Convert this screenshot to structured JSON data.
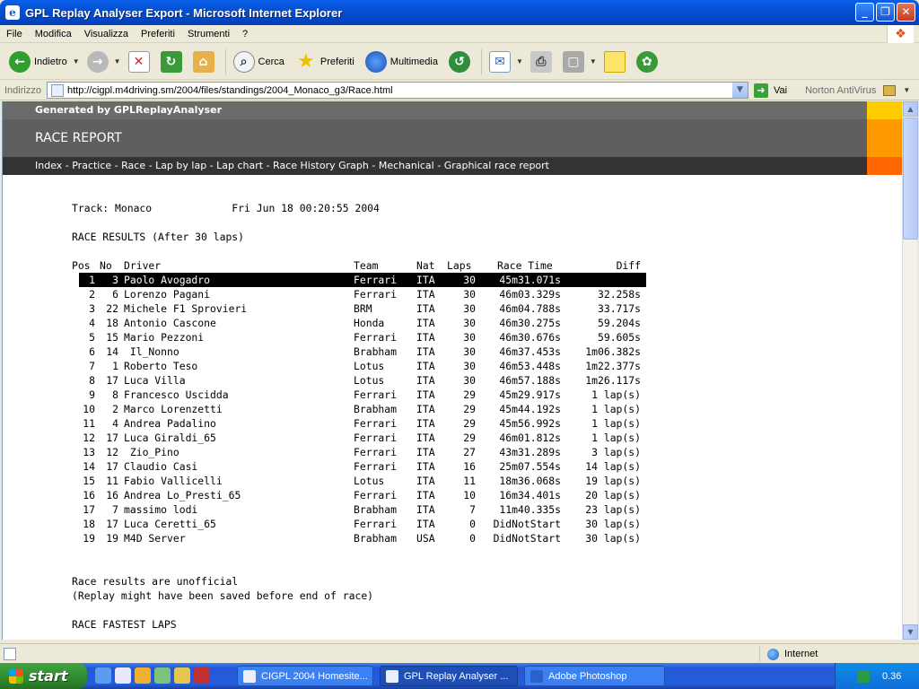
{
  "window": {
    "title": "GPL Replay Analyser Export - Microsoft Internet Explorer"
  },
  "menu": [
    "File",
    "Modifica",
    "Visualizza",
    "Preferiti",
    "Strumenti",
    "?"
  ],
  "toolbar": {
    "back": "Indietro",
    "search": "Cerca",
    "favorites": "Preferiti",
    "media": "Multimedia"
  },
  "address": {
    "label": "Indirizzo",
    "url": "http://cigpl.m4driving.sm/2004/files/standings/2004_Monaco_g3/Race.html",
    "go": "Vai",
    "norton": "Norton AntiVirus"
  },
  "page": {
    "generated_by": "Generated by GPLReplayAnalyser",
    "report_title": "RACE REPORT",
    "nav": "Index - Practice - Race - Lap by lap - Lap chart - Race History Graph - Mechanical - Graphical race report",
    "track_line": "Track: Monaco             Fri Jun 18 00:20:55 2004",
    "results_heading": "RACE RESULTS (After 30 laps)",
    "columns": {
      "pos": "Pos",
      "no": "No",
      "driver": "Driver",
      "team": "Team",
      "nat": "Nat",
      "laps": "Laps",
      "time": "Race Time",
      "diff": "Diff"
    },
    "results": [
      {
        "pos": "1",
        "no": "3",
        "driver": "Paolo Avogadro",
        "team": "Ferrari",
        "nat": "ITA",
        "laps": "30",
        "time": "45m31.071s",
        "diff": ""
      },
      {
        "pos": "2",
        "no": "6",
        "driver": "Lorenzo Pagani",
        "team": "Ferrari",
        "nat": "ITA",
        "laps": "30",
        "time": "46m03.329s",
        "diff": "32.258s"
      },
      {
        "pos": "3",
        "no": "22",
        "driver": "Michele F1 Sprovieri",
        "team": "BRM",
        "nat": "ITA",
        "laps": "30",
        "time": "46m04.788s",
        "diff": "33.717s"
      },
      {
        "pos": "4",
        "no": "18",
        "driver": "Antonio Cascone",
        "team": "Honda",
        "nat": "ITA",
        "laps": "30",
        "time": "46m30.275s",
        "diff": "59.204s"
      },
      {
        "pos": "5",
        "no": "15",
        "driver": "Mario Pezzoni",
        "team": "Ferrari",
        "nat": "ITA",
        "laps": "30",
        "time": "46m30.676s",
        "diff": "59.605s"
      },
      {
        "pos": "6",
        "no": "14",
        "driver": " Il_Nonno",
        "team": "Brabham",
        "nat": "ITA",
        "laps": "30",
        "time": "46m37.453s",
        "diff": "1m06.382s"
      },
      {
        "pos": "7",
        "no": "1",
        "driver": "Roberto Teso",
        "team": "Lotus",
        "nat": "ITA",
        "laps": "30",
        "time": "46m53.448s",
        "diff": "1m22.377s"
      },
      {
        "pos": "8",
        "no": "17",
        "driver": "Luca Villa",
        "team": "Lotus",
        "nat": "ITA",
        "laps": "30",
        "time": "46m57.188s",
        "diff": "1m26.117s"
      },
      {
        "pos": "9",
        "no": "8",
        "driver": "Francesco Uscidda",
        "team": "Ferrari",
        "nat": "ITA",
        "laps": "29",
        "time": "45m29.917s",
        "diff": "1 lap(s)"
      },
      {
        "pos": "10",
        "no": "2",
        "driver": "Marco Lorenzetti",
        "team": "Brabham",
        "nat": "ITA",
        "laps": "29",
        "time": "45m44.192s",
        "diff": "1 lap(s)"
      },
      {
        "pos": "11",
        "no": "4",
        "driver": "Andrea Padalino",
        "team": "Ferrari",
        "nat": "ITA",
        "laps": "29",
        "time": "45m56.992s",
        "diff": "1 lap(s)"
      },
      {
        "pos": "12",
        "no": "17",
        "driver": "Luca Giraldi_65",
        "team": "Ferrari",
        "nat": "ITA",
        "laps": "29",
        "time": "46m01.812s",
        "diff": "1 lap(s)"
      },
      {
        "pos": "13",
        "no": "12",
        "driver": " Zio_Pino",
        "team": "Ferrari",
        "nat": "ITA",
        "laps": "27",
        "time": "43m31.289s",
        "diff": "3 lap(s)"
      },
      {
        "pos": "14",
        "no": "17",
        "driver": "Claudio Casi",
        "team": "Ferrari",
        "nat": "ITA",
        "laps": "16",
        "time": "25m07.554s",
        "diff": "14 lap(s)"
      },
      {
        "pos": "15",
        "no": "11",
        "driver": "Fabio Vallicelli",
        "team": "Lotus",
        "nat": "ITA",
        "laps": "11",
        "time": "18m36.068s",
        "diff": "19 lap(s)"
      },
      {
        "pos": "16",
        "no": "16",
        "driver": "Andrea Lo_Presti_65",
        "team": "Ferrari",
        "nat": "ITA",
        "laps": "10",
        "time": "16m34.401s",
        "diff": "20 lap(s)"
      },
      {
        "pos": "17",
        "no": "7",
        "driver": "massimo lodi",
        "team": "Brabham",
        "nat": "ITA",
        "laps": "7",
        "time": "11m40.335s",
        "diff": "23 lap(s)"
      },
      {
        "pos": "18",
        "no": "17",
        "driver": "Luca Ceretti_65",
        "team": "Ferrari",
        "nat": "ITA",
        "laps": "0",
        "time": "DidNotStart",
        "diff": "30 lap(s)"
      },
      {
        "pos": "19",
        "no": "19",
        "driver": "M4D Server",
        "team": "Brabham",
        "nat": "USA",
        "laps": "0",
        "time": "DidNotStart",
        "diff": "30 lap(s)"
      }
    ],
    "unofficial_note": "Race results are unofficial",
    "replay_note": "(Replay might have been saved before end of race)",
    "fastest_heading": "RACE FASTEST LAPS"
  },
  "status": {
    "zone": "Internet"
  },
  "taskbar": {
    "start": "start",
    "tasks": [
      "CIGPL 2004 Homesite...",
      "GPL Replay Analyser ...",
      "Adobe Photoshop"
    ],
    "clock": "0.36"
  },
  "colors": {
    "banner_yellow": "#ffcc00",
    "banner_orange": "#ff9900",
    "banner_red": "#ff6600",
    "xp_blue": "#0450D2"
  }
}
